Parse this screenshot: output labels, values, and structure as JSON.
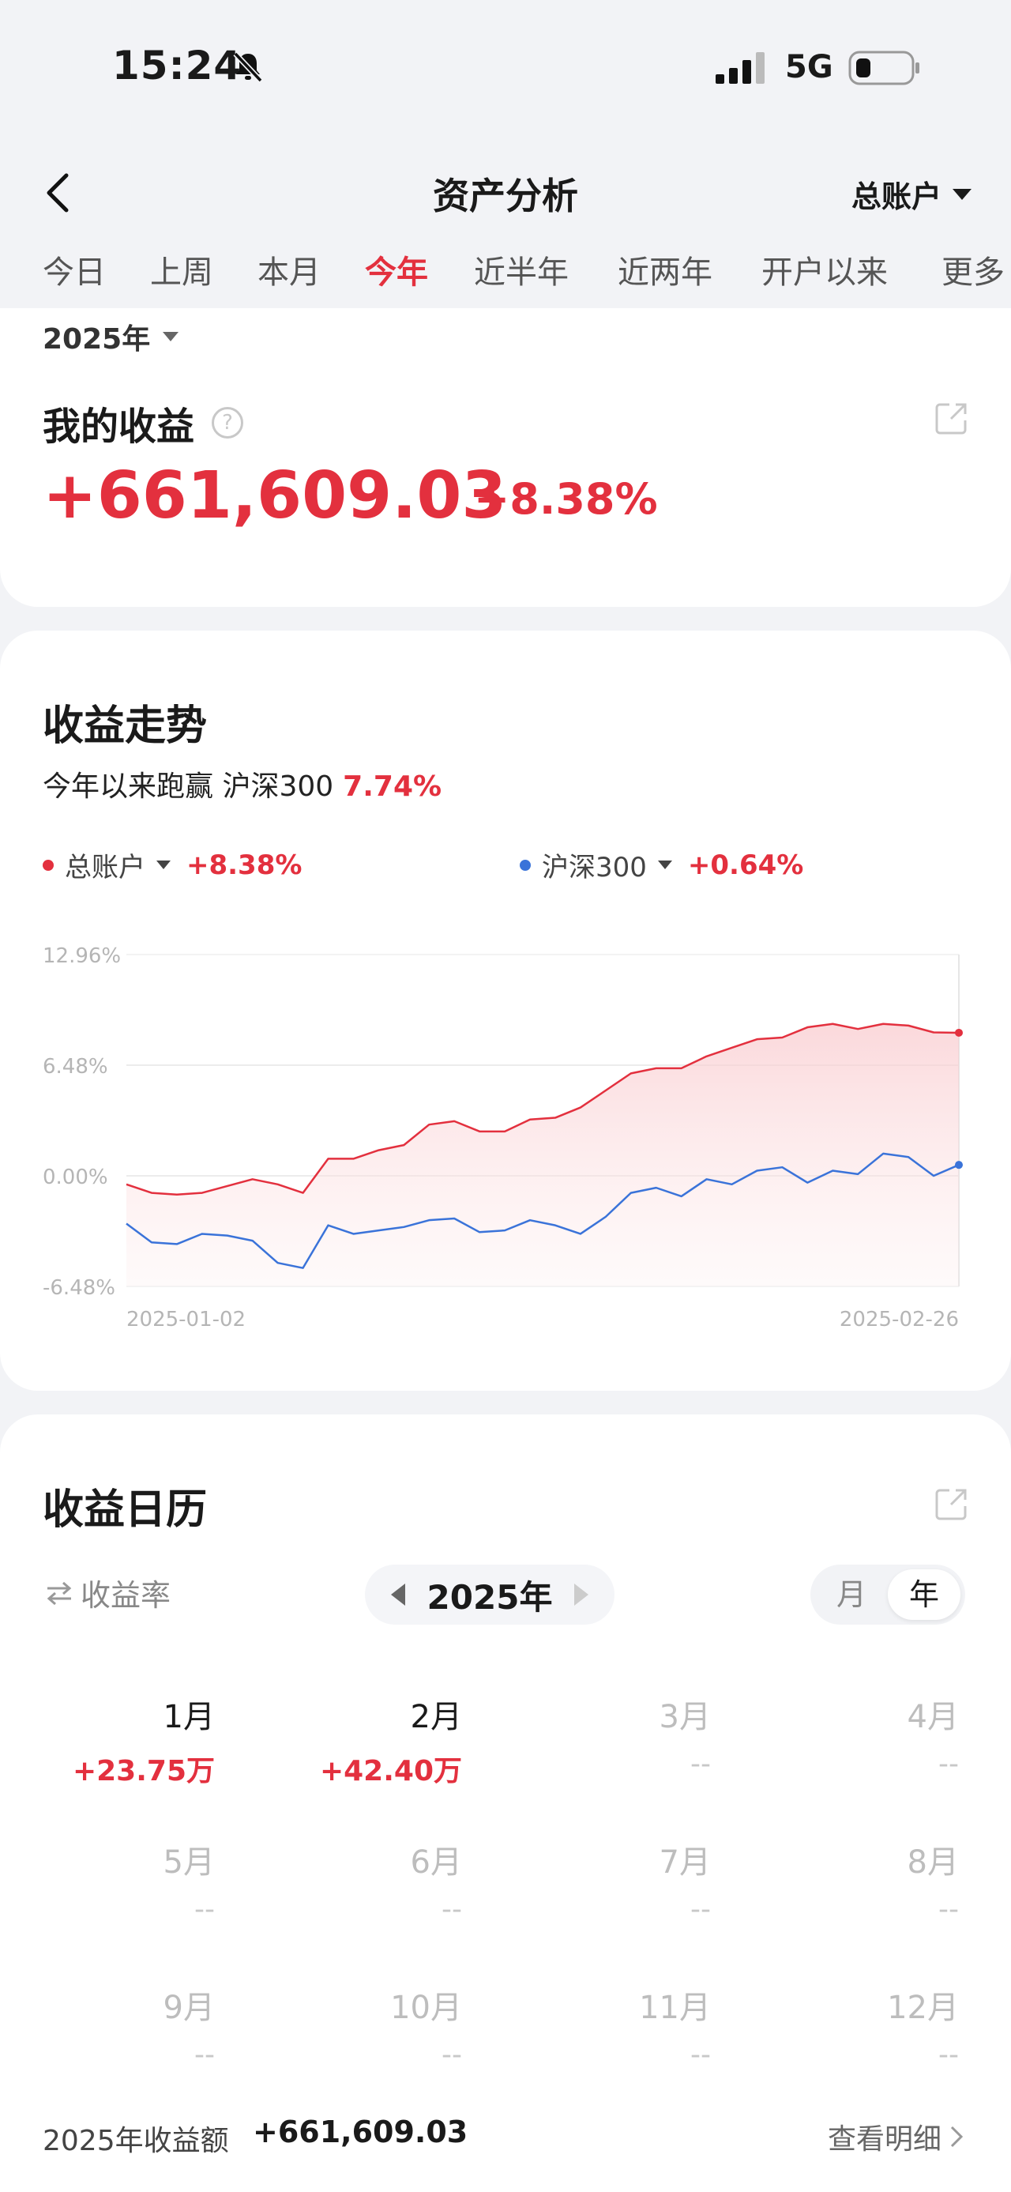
{
  "status": {
    "time": "15:24",
    "network": "5G"
  },
  "nav": {
    "title": "资产分析",
    "account": "总账户"
  },
  "tabs": [
    "今日",
    "上周",
    "本月",
    "今年",
    "近半年",
    "近两年",
    "开户以来",
    "更多"
  ],
  "active_tab": "今年",
  "summary": {
    "year": "2025年",
    "title": "我的收益",
    "amount": "+661,609.03",
    "pct": "+8.38%"
  },
  "trend": {
    "title": "收益走势",
    "subtitle": "今年以来跑赢 沪深300",
    "outperform": "7.74%",
    "legend": [
      {
        "name": "总账户",
        "pct": "+8.38%",
        "color": "#e3303e"
      },
      {
        "name": "沪深300",
        "pct": "+0.64%",
        "color": "#3a73d9"
      }
    ]
  },
  "chart_data": {
    "type": "line",
    "x_start": "2025-01-02",
    "x_end": "2025-02-26",
    "y_ticks": [
      "12.96%",
      "6.48%",
      "0.00%",
      "-6.48%"
    ],
    "ylim": [
      -6.48,
      12.96
    ],
    "series": [
      {
        "name": "总账户",
        "color": "#e3303e",
        "values": [
          -0.5,
          -1.0,
          -1.1,
          -1.0,
          -0.6,
          -0.2,
          -0.5,
          -1.0,
          1.0,
          1.0,
          1.5,
          1.8,
          3.0,
          3.2,
          2.6,
          2.6,
          3.3,
          3.4,
          4.0,
          5.0,
          6.0,
          6.3,
          6.3,
          7.0,
          7.5,
          8.0,
          8.1,
          8.7,
          8.9,
          8.6,
          8.9,
          8.8,
          8.4,
          8.38
        ]
      },
      {
        "name": "沪深300",
        "color": "#3a73d9",
        "values": [
          -2.8,
          -3.9,
          -4.0,
          -3.4,
          -3.5,
          -3.8,
          -5.1,
          -5.4,
          -2.9,
          -3.4,
          -3.2,
          -3.0,
          -2.6,
          -2.5,
          -3.3,
          -3.2,
          -2.6,
          -2.9,
          -3.4,
          -2.4,
          -1.0,
          -0.7,
          -1.2,
          -0.2,
          -0.5,
          0.3,
          0.5,
          -0.4,
          0.3,
          0.1,
          1.3,
          1.1,
          0.0,
          0.64
        ]
      }
    ]
  },
  "calendar": {
    "title": "收益日历",
    "toggle": "收益率",
    "year": "2025年",
    "seg_month": "月",
    "seg_year": "年",
    "months": [
      {
        "name": "1月",
        "value": "+23.75万"
      },
      {
        "name": "2月",
        "value": "+42.40万"
      },
      {
        "name": "3月",
        "value": "--"
      },
      {
        "name": "4月",
        "value": "--"
      },
      {
        "name": "5月",
        "value": "--"
      },
      {
        "name": "6月",
        "value": "--"
      },
      {
        "name": "7月",
        "value": "--"
      },
      {
        "name": "8月",
        "value": "--"
      },
      {
        "name": "9月",
        "value": "--"
      },
      {
        "name": "10月",
        "value": "--"
      },
      {
        "name": "11月",
        "value": "--"
      },
      {
        "name": "12月",
        "value": "--"
      }
    ],
    "footer_label": "2025年收益额",
    "footer_value": "+661,609.03",
    "detail_link": "查看明细"
  }
}
